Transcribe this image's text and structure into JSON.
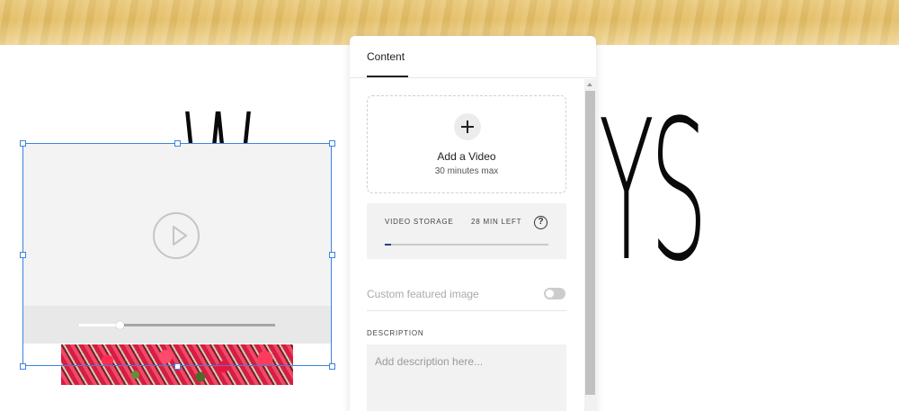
{
  "page": {
    "heading_left": "W",
    "heading_right": "YS"
  },
  "video_block": {
    "scrubber_progress": 0.21,
    "icons": {
      "play": "play-circle-icon"
    }
  },
  "panel": {
    "tabs": [
      {
        "label": "Content",
        "active": true
      }
    ],
    "upload": {
      "title": "Add a Video",
      "subtitle": "30 minutes max",
      "icon": "plus-icon"
    },
    "storage": {
      "label": "VIDEO STORAGE",
      "remaining": "28 MIN LEFT",
      "help_glyph": "?",
      "used_fraction": 0.04
    },
    "featured_image": {
      "label": "Custom featured image",
      "enabled": false
    },
    "description": {
      "label": "DESCRIPTION",
      "placeholder": "Add description here...",
      "value": ""
    }
  },
  "colors": {
    "selection": "#3d83e0",
    "storage_fill": "#2b3e8c",
    "banner": "#e3bd64"
  }
}
